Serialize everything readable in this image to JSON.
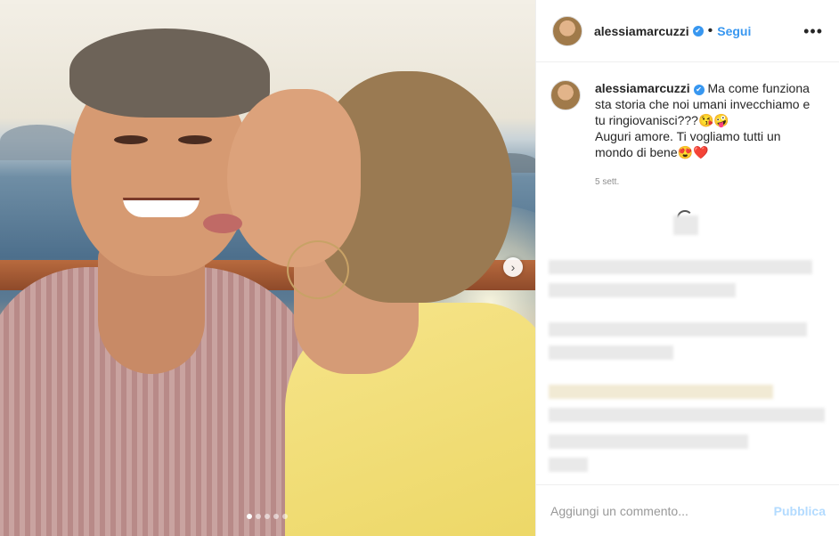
{
  "post": {
    "username": "alessiamarcuzzi",
    "verified_icon": "✔",
    "separator": "•",
    "follow_label": "Segui",
    "more_icon": "•••",
    "caption_line1": "Ma come funziona sta storia che noi umani invecchiamo e tu ringiovanisci???😘🤪",
    "caption_line2": "Auguri amore. Ti vogliamo tutti un mondo di bene😍❤️",
    "timestamp": "5 sett."
  },
  "carousel": {
    "next_icon": "›",
    "dots": 5,
    "active_dot": 0
  },
  "composer": {
    "placeholder": "Aggiungi un commento...",
    "publish_label": "Pubblica"
  },
  "colors": {
    "accent": "#3897f0",
    "publish_disabled": "#b3dbff"
  }
}
